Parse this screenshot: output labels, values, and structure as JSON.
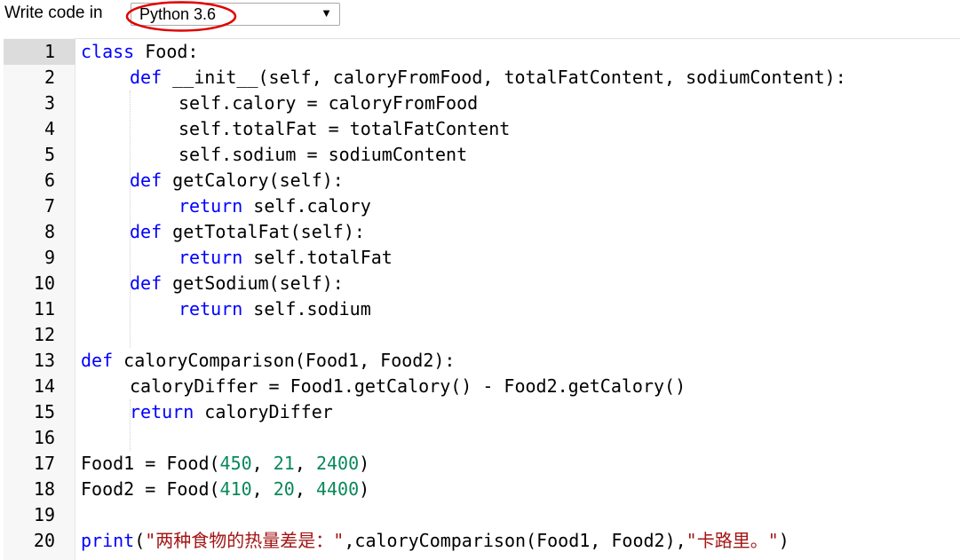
{
  "toolbar": {
    "label": "Write code in",
    "language_selected": "Python 3.6"
  },
  "editor": {
    "lines": [
      {
        "number": "1"
      },
      {
        "number": "2"
      },
      {
        "number": "3"
      },
      {
        "number": "4"
      },
      {
        "number": "5"
      },
      {
        "number": "6"
      },
      {
        "number": "7"
      },
      {
        "number": "8"
      },
      {
        "number": "9"
      },
      {
        "number": "10"
      },
      {
        "number": "11"
      },
      {
        "number": "12"
      },
      {
        "number": "13"
      },
      {
        "number": "14"
      },
      {
        "number": "15"
      },
      {
        "number": "16"
      },
      {
        "number": "17"
      },
      {
        "number": "18"
      },
      {
        "number": "19"
      },
      {
        "number": "20"
      }
    ],
    "tokens": {
      "l1_kw": "class",
      "l1_rest": " Food:",
      "l2_kw": "def",
      "l2_rest": " __init__(self, caloryFromFood, totalFatContent, sodiumContent):",
      "l3": "self.calory = caloryFromFood",
      "l4": "self.totalFat = totalFatContent",
      "l5": "self.sodium = sodiumContent",
      "l6_kw": "def",
      "l6_rest": " getCalory(self):",
      "l7_kw": "return",
      "l7_rest": " self.calory",
      "l8_kw": "def",
      "l8_rest": " getTotalFat(self):",
      "l9_kw": "return",
      "l9_rest": " self.totalFat",
      "l10_kw": "def",
      "l10_rest": " getSodium(self):",
      "l11_kw": "return",
      "l11_rest": " self.sodium",
      "l13_kw": "def",
      "l13_rest": " caloryComparison(Food1, Food2):",
      "l14": "caloryDiffer = Food1.getCalory() - Food2.getCalory()",
      "l15_kw": "return",
      "l15_rest": " caloryDiffer",
      "l17_a": "Food1 = Food(",
      "l17_n1": "450",
      "l17_c1": ", ",
      "l17_n2": "21",
      "l17_c2": ", ",
      "l17_n3": "2400",
      "l17_e": ")",
      "l18_a": "Food2 = Food(",
      "l18_n1": "410",
      "l18_c1": ", ",
      "l18_n2": "20",
      "l18_c2": ", ",
      "l18_n3": "4400",
      "l18_e": ")",
      "l20_kw": "print",
      "l20_p": "(",
      "l20_s1": "\"两种食物的热量差是：\"",
      "l20_mid": ",caloryComparison(Food1, Food2),",
      "l20_s2": "\"卡路里。\"",
      "l20_e": ")"
    }
  },
  "colors": {
    "keyword": "#0000ff",
    "number": "#09885a",
    "string": "#a31515",
    "annotation": "#e00000"
  },
  "icons": [
    "dropdown-arrow-icon"
  ]
}
